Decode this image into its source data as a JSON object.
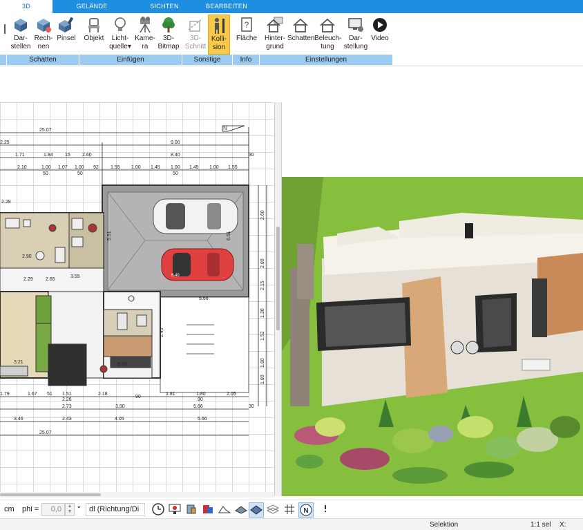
{
  "tabs": [
    "3D",
    "GELÄNDE",
    "SICHTEN",
    "BEARBEITEN"
  ],
  "ribbon": {
    "buttons": {
      "darstellen": [
        "Dar-",
        "stellen"
      ],
      "rechnen": [
        "Rech-",
        "nen"
      ],
      "pinsel": [
        "Pinsel"
      ],
      "objekt": [
        "Objekt"
      ],
      "lichtquelle": [
        "Licht-",
        "quelle"
      ],
      "kamera": [
        "Kame-",
        "ra"
      ],
      "bitmap": [
        "3D-",
        "Bitmap"
      ],
      "schnitt": [
        "3D-",
        "Schnitt"
      ],
      "kollision": [
        "Kolli-",
        "sion"
      ],
      "flaeche": [
        "Fläche"
      ],
      "hintergrund": [
        "Hinter-",
        "grund"
      ],
      "schatten": [
        "Schatten"
      ],
      "beleuchtung": [
        "Beleuch-",
        "tung"
      ],
      "darstellung": [
        "Dar-",
        "stellung"
      ],
      "video": [
        "Video"
      ]
    },
    "groups": [
      "Schatten",
      "Einfügen",
      "Sonstige",
      "Info",
      "Einstellungen"
    ]
  },
  "plan": {
    "dims": {
      "top_total": "25.07",
      "d225": "2.25",
      "d900": "9.00",
      "d171": "1.71",
      "d184": "1.84",
      "d15": "15",
      "d260": "2.60",
      "d840": "8.40",
      "d30": "30",
      "d210": "2.10",
      "d100a": "1.00",
      "d107": "1.07",
      "d100b": "1.00",
      "d92": "92",
      "d155": "1.55",
      "d100c": "1.00",
      "d145": "1.45",
      "d100d": "1.00",
      "d145b": "1.45",
      "d100e": "1.00",
      "d155b": "1.55",
      "d50a": "50",
      "d50b": "50",
      "d50c": "50",
      "d228": "2.28",
      "d591": "5.91",
      "d651": "6.51",
      "d260v": "2.60",
      "d280": "2.80",
      "d215": "2.15",
      "d130": "1.30",
      "d152": "1.52",
      "d180": "1.80",
      "d180b": "1.80",
      "d229": "2.29",
      "d265": "2.65",
      "d355": "3.55",
      "d566": "5.66",
      "d290": "2.90",
      "d321": "3.21",
      "d590": "5.90",
      "d240": "2.40",
      "b179": "1.79",
      "b167": "1.67",
      "b51": "51",
      "b151": "1.51",
      "b218": "2.18",
      "b181": "1.81",
      "b180": "1.80",
      "b205": "2.05",
      "b90a": "90",
      "b90b": "90",
      "b226": "2.26",
      "b273": "2.73",
      "b390": "3.90",
      "b566": "5.66",
      "b346": "3.46",
      "b243": "2.43",
      "b405": "4.05",
      "b566b": "5.66",
      "b2507": "25.07",
      "b30": "30"
    }
  },
  "toolbar": {
    "unit": "cm",
    "phi_label": "phi =",
    "phi_value": "0,0",
    "degree": "°",
    "dl_select": "dl (Richtung/Di"
  },
  "status": {
    "mode": "Selektion",
    "scale": "1:1 sel",
    "x_label": "X:"
  },
  "colors": {
    "tab_blue": "#1e8fe0",
    "group_bar": "#9ccbf1",
    "active_button": "#f6c94a",
    "grass": "#86bf3e"
  }
}
